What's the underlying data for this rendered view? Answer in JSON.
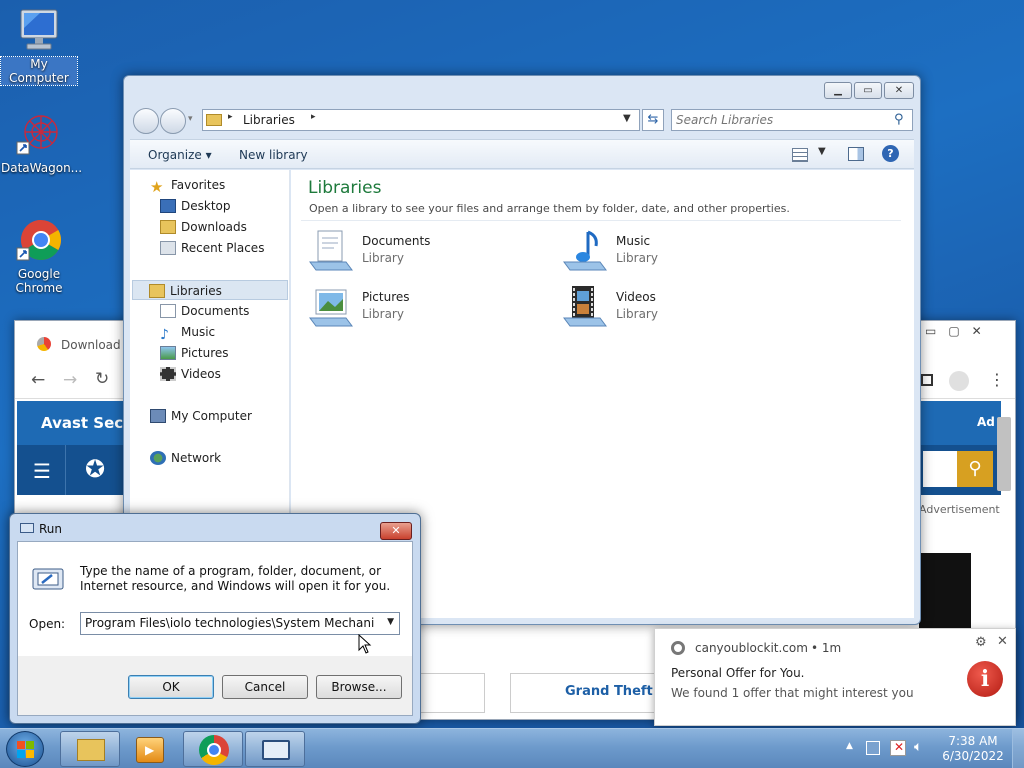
{
  "desktop": {
    "icons": [
      {
        "label": "My Computer"
      },
      {
        "label": "DataWagon..."
      },
      {
        "label": "Google Chrome"
      }
    ]
  },
  "explorer": {
    "address": "Libraries",
    "search_placeholder": "Search Libraries",
    "toolbar": {
      "organize": "Organize",
      "new_library": "New library"
    },
    "nav": {
      "favorites": "Favorites",
      "desktop": "Desktop",
      "downloads": "Downloads",
      "recent": "Recent Places",
      "libraries": "Libraries",
      "documents": "Documents",
      "music": "Music",
      "pictures": "Pictures",
      "videos": "Videos",
      "computer": "My Computer",
      "network": "Network"
    },
    "heading": "Libraries",
    "subheading": "Open a library to see your files and arrange them by folder, date, and other properties.",
    "libraries": [
      {
        "name": "Documents",
        "type": "Library"
      },
      {
        "name": "Music",
        "type": "Library"
      },
      {
        "name": "Pictures",
        "type": "Library"
      },
      {
        "name": "Videos",
        "type": "Library"
      }
    ]
  },
  "chrome": {
    "tab_title": "Download T",
    "banner_text": "Avast Secu",
    "ad_short": "Ad",
    "advertisement": "Advertisement",
    "gta_text": "Grand Theft A"
  },
  "run": {
    "title": "Run",
    "description": "Type the name of a program, folder, document, or Internet resource, and Windows will open it for you.",
    "open_label": "Open:",
    "input_value": "Program Files\\iolo technologies\\System Mechanic\\Sys\"",
    "ok": "OK",
    "cancel": "Cancel",
    "browse": "Browse..."
  },
  "notification": {
    "source": "canyoublockit.com",
    "age": "• 1m",
    "title": "Personal Offer for You.",
    "message": "We found 1 offer that might interest you"
  },
  "taskbar": {
    "time": "7:38 AM",
    "date": "6/30/2022"
  },
  "colors": {
    "heading": "#1e7a3c",
    "accent_blue": "#1d5fa6",
    "search_gold": "#d7a021"
  }
}
